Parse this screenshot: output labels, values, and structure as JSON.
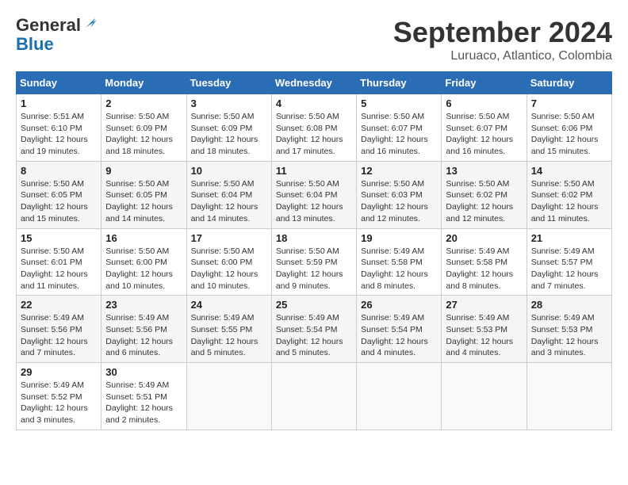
{
  "logo": {
    "general": "General",
    "blue": "Blue"
  },
  "header": {
    "month": "September 2024",
    "location": "Luruaco, Atlantico, Colombia"
  },
  "weekdays": [
    "Sunday",
    "Monday",
    "Tuesday",
    "Wednesday",
    "Thursday",
    "Friday",
    "Saturday"
  ],
  "weeks": [
    [
      {
        "day": "1",
        "sunrise": "5:51 AM",
        "sunset": "6:10 PM",
        "daylight": "12 hours and 19 minutes."
      },
      {
        "day": "2",
        "sunrise": "5:50 AM",
        "sunset": "6:09 PM",
        "daylight": "12 hours and 18 minutes."
      },
      {
        "day": "3",
        "sunrise": "5:50 AM",
        "sunset": "6:09 PM",
        "daylight": "12 hours and 18 minutes."
      },
      {
        "day": "4",
        "sunrise": "5:50 AM",
        "sunset": "6:08 PM",
        "daylight": "12 hours and 17 minutes."
      },
      {
        "day": "5",
        "sunrise": "5:50 AM",
        "sunset": "6:07 PM",
        "daylight": "12 hours and 16 minutes."
      },
      {
        "day": "6",
        "sunrise": "5:50 AM",
        "sunset": "6:07 PM",
        "daylight": "12 hours and 16 minutes."
      },
      {
        "day": "7",
        "sunrise": "5:50 AM",
        "sunset": "6:06 PM",
        "daylight": "12 hours and 15 minutes."
      }
    ],
    [
      {
        "day": "8",
        "sunrise": "5:50 AM",
        "sunset": "6:05 PM",
        "daylight": "12 hours and 15 minutes."
      },
      {
        "day": "9",
        "sunrise": "5:50 AM",
        "sunset": "6:05 PM",
        "daylight": "12 hours and 14 minutes."
      },
      {
        "day": "10",
        "sunrise": "5:50 AM",
        "sunset": "6:04 PM",
        "daylight": "12 hours and 14 minutes."
      },
      {
        "day": "11",
        "sunrise": "5:50 AM",
        "sunset": "6:04 PM",
        "daylight": "12 hours and 13 minutes."
      },
      {
        "day": "12",
        "sunrise": "5:50 AM",
        "sunset": "6:03 PM",
        "daylight": "12 hours and 12 minutes."
      },
      {
        "day": "13",
        "sunrise": "5:50 AM",
        "sunset": "6:02 PM",
        "daylight": "12 hours and 12 minutes."
      },
      {
        "day": "14",
        "sunrise": "5:50 AM",
        "sunset": "6:02 PM",
        "daylight": "12 hours and 11 minutes."
      }
    ],
    [
      {
        "day": "15",
        "sunrise": "5:50 AM",
        "sunset": "6:01 PM",
        "daylight": "12 hours and 11 minutes."
      },
      {
        "day": "16",
        "sunrise": "5:50 AM",
        "sunset": "6:00 PM",
        "daylight": "12 hours and 10 minutes."
      },
      {
        "day": "17",
        "sunrise": "5:50 AM",
        "sunset": "6:00 PM",
        "daylight": "12 hours and 10 minutes."
      },
      {
        "day": "18",
        "sunrise": "5:50 AM",
        "sunset": "5:59 PM",
        "daylight": "12 hours and 9 minutes."
      },
      {
        "day": "19",
        "sunrise": "5:49 AM",
        "sunset": "5:58 PM",
        "daylight": "12 hours and 8 minutes."
      },
      {
        "day": "20",
        "sunrise": "5:49 AM",
        "sunset": "5:58 PM",
        "daylight": "12 hours and 8 minutes."
      },
      {
        "day": "21",
        "sunrise": "5:49 AM",
        "sunset": "5:57 PM",
        "daylight": "12 hours and 7 minutes."
      }
    ],
    [
      {
        "day": "22",
        "sunrise": "5:49 AM",
        "sunset": "5:56 PM",
        "daylight": "12 hours and 7 minutes."
      },
      {
        "day": "23",
        "sunrise": "5:49 AM",
        "sunset": "5:56 PM",
        "daylight": "12 hours and 6 minutes."
      },
      {
        "day": "24",
        "sunrise": "5:49 AM",
        "sunset": "5:55 PM",
        "daylight": "12 hours and 5 minutes."
      },
      {
        "day": "25",
        "sunrise": "5:49 AM",
        "sunset": "5:54 PM",
        "daylight": "12 hours and 5 minutes."
      },
      {
        "day": "26",
        "sunrise": "5:49 AM",
        "sunset": "5:54 PM",
        "daylight": "12 hours and 4 minutes."
      },
      {
        "day": "27",
        "sunrise": "5:49 AM",
        "sunset": "5:53 PM",
        "daylight": "12 hours and 4 minutes."
      },
      {
        "day": "28",
        "sunrise": "5:49 AM",
        "sunset": "5:53 PM",
        "daylight": "12 hours and 3 minutes."
      }
    ],
    [
      {
        "day": "29",
        "sunrise": "5:49 AM",
        "sunset": "5:52 PM",
        "daylight": "12 hours and 3 minutes."
      },
      {
        "day": "30",
        "sunrise": "5:49 AM",
        "sunset": "5:51 PM",
        "daylight": "12 hours and 2 minutes."
      },
      null,
      null,
      null,
      null,
      null
    ]
  ],
  "labels": {
    "sunrise": "Sunrise:",
    "sunset": "Sunset:",
    "daylight": "Daylight:"
  }
}
